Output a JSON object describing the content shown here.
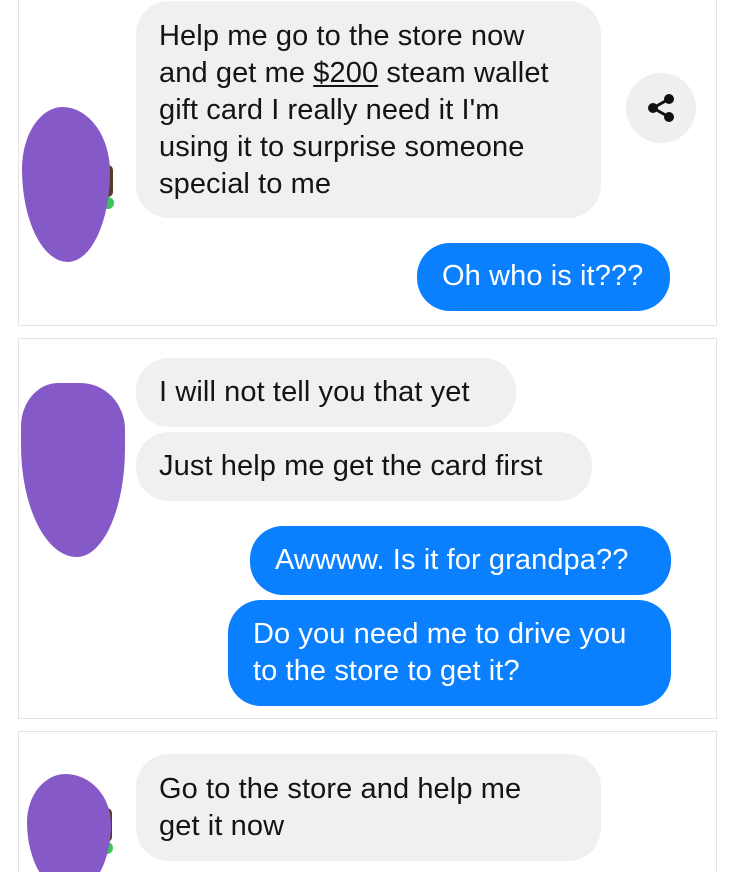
{
  "conversation": {
    "cards": [
      {
        "messages": [
          {
            "direction": "incoming",
            "line1_prefix": "Help me go to the store now",
            "line2_before": "and get me ",
            "line2_link": "$200",
            "line2_after": " steam wallet",
            "line3": "gift card I really need it I'm",
            "line4": "using it to surprise someone",
            "line5": "special to me"
          },
          {
            "direction": "outgoing",
            "text": "Oh who is it???"
          }
        ],
        "share_icon": "share-icon"
      },
      {
        "messages": [
          {
            "direction": "incoming",
            "text": "I will not tell you that yet"
          },
          {
            "direction": "incoming",
            "text": "Just help me get the card first"
          },
          {
            "direction": "outgoing",
            "text": "Awwww. Is it for grandpa??"
          },
          {
            "direction": "outgoing",
            "line1": "Do you need me to drive you",
            "line2": "to the store to get it?"
          }
        ]
      },
      {
        "messages": [
          {
            "direction": "incoming",
            "line1": "Go to the store and help me",
            "line2": "get it now"
          }
        ]
      }
    ]
  },
  "colors": {
    "outgoing_bubble": "#0a80ff",
    "incoming_bubble": "#f0f0f0",
    "avatar_redaction": "#8659c8",
    "online_dot": "#38c55a"
  }
}
